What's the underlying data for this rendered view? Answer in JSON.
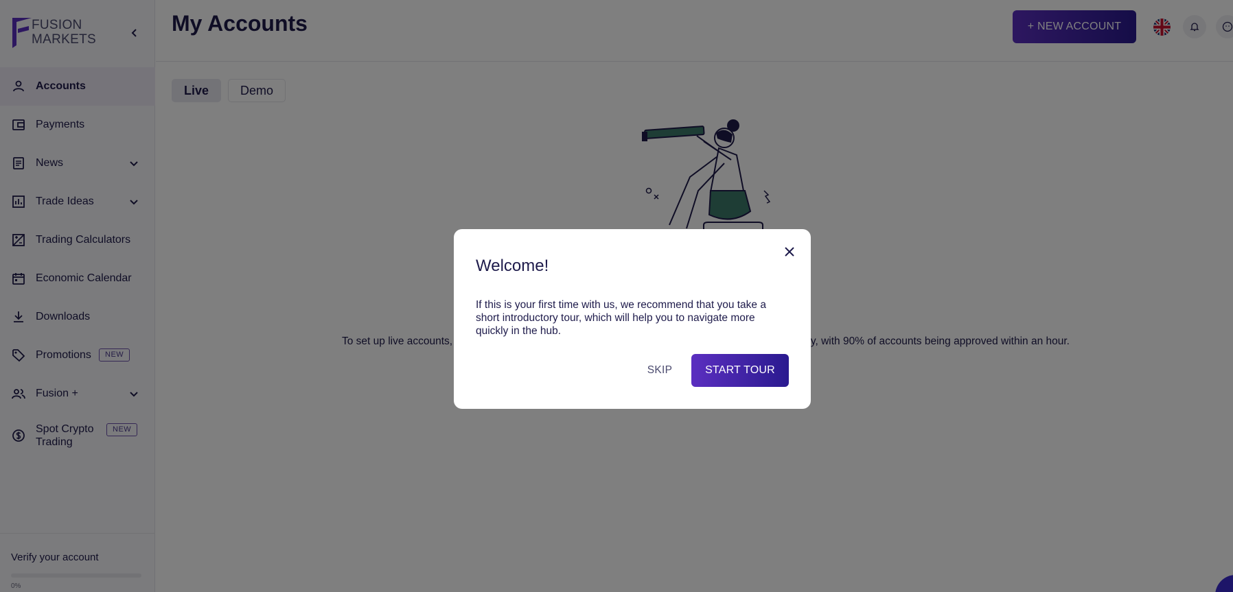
{
  "brand": {
    "name_line1": "FUSION",
    "name_line2": "MARKETS",
    "accent": "#5b2fc0"
  },
  "sidebar": {
    "items": [
      {
        "label": "Accounts",
        "icon": "user-icon",
        "active": true
      },
      {
        "label": "Payments",
        "icon": "wallet-icon"
      },
      {
        "label": "News",
        "icon": "newspaper-icon",
        "expandable": true
      },
      {
        "label": "Trade Ideas",
        "icon": "bar-chart-icon",
        "expandable": true
      },
      {
        "label": "Trading Calculators",
        "icon": "calculator-icon"
      },
      {
        "label": "Economic Calendar",
        "icon": "calendar-icon"
      },
      {
        "label": "Downloads",
        "icon": "download-icon"
      },
      {
        "label": "Promotions",
        "icon": "tag-icon",
        "badge": "NEW"
      },
      {
        "label": "Fusion +",
        "icon": "people-icon",
        "expandable": true
      },
      {
        "label": "Spot Crypto Trading",
        "icon": "dollar-circle-icon",
        "badge": "NEW"
      }
    ],
    "verify": {
      "label": "Verify your account",
      "progress_text": "0%",
      "progress": 0
    }
  },
  "header": {
    "title": "My Accounts",
    "new_account_label": "+ NEW ACCOUNT"
  },
  "tabs": [
    {
      "label": "Live",
      "active": true
    },
    {
      "label": "Demo"
    }
  ],
  "main": {
    "info_left": "To set up live accounts, y",
    "info_right": "y, with 90% of accounts being approved within an hour."
  },
  "modal": {
    "title": "Welcome!",
    "body": "If this is your first time with us, we recommend that you take a short introductory tour, which will help you to navigate more quickly in the hub.",
    "skip_label": "SKIP",
    "start_label": "START TOUR"
  }
}
